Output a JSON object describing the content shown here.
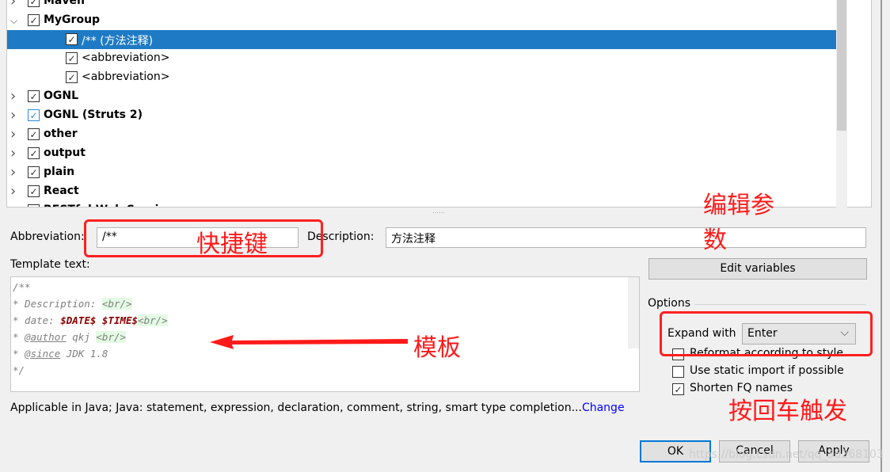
{
  "tree": {
    "items": [
      {
        "label": "Maven",
        "bold": true,
        "checked": true,
        "level": 0,
        "expanded": false
      },
      {
        "label": "MyGroup",
        "bold": true,
        "checked": true,
        "level": 0,
        "expanded": true
      },
      {
        "label": "/** (方法注释)",
        "bold": false,
        "checked": true,
        "level": 1,
        "selected": true
      },
      {
        "label": "<abbreviation>",
        "bold": false,
        "checked": true,
        "level": 1
      },
      {
        "label": "<abbreviation>",
        "bold": false,
        "checked": true,
        "level": 1
      },
      {
        "label": "OGNL",
        "bold": true,
        "checked": true,
        "level": 0,
        "expanded": false
      },
      {
        "label": "OGNL (Struts 2)",
        "bold": true,
        "checked": true,
        "level": 0,
        "expanded": false
      },
      {
        "label": "other",
        "bold": true,
        "checked": true,
        "level": 0,
        "expanded": false
      },
      {
        "label": "output",
        "bold": true,
        "checked": true,
        "level": 0,
        "expanded": false
      },
      {
        "label": "plain",
        "bold": true,
        "checked": true,
        "level": 0,
        "expanded": false
      },
      {
        "label": "React",
        "bold": true,
        "checked": true,
        "level": 0,
        "expanded": false
      },
      {
        "label": "RESTful Web Services",
        "bold": true,
        "checked": true,
        "level": 0,
        "expanded": false
      }
    ]
  },
  "form": {
    "abbreviation_label": "Abbreviation:",
    "abbreviation_value": "/**",
    "description_label": "Description:",
    "description_value": "方法注释",
    "template_label": "Template text:",
    "template_lines": {
      "l1": "/**",
      "l2a": "* Description: ",
      "l2b": "<br/>",
      "l3a": "* date: ",
      "l3b": "$DATE$",
      "l3c": " ",
      "l3d": "$TIME$",
      "l3e": "<br/>",
      "l4a": "* ",
      "l4b": "@author",
      "l4c": " qkj ",
      "l4d": "<br/>",
      "l5a": "* ",
      "l5b": "@since",
      "l5c": " JDK 1.8",
      "l6": "*/"
    },
    "edit_variables": "Edit variables",
    "options_label": "Options",
    "expand_with_label": "Expand with",
    "expand_with_value": "Enter",
    "reformat": {
      "label": "Reformat according to style",
      "checked": false
    },
    "static_import": {
      "label": "Use static import if possible",
      "checked": false
    },
    "shorten_fq": {
      "label": "Shorten FQ names",
      "checked": true
    },
    "applicable": "Applicable in Java; Java: statement, expression, declaration, comment, string, smart type completion...",
    "change_link": "Change"
  },
  "buttons": {
    "ok": "OK",
    "cancel": "Cancel",
    "apply": "Apply"
  },
  "annotations": {
    "shortcut": "快捷键",
    "edit_params": "编辑参数",
    "template": "模板",
    "enter_trigger": "按回车触发"
  },
  "watermark": "https://blog.csdn.net/qq_36268103",
  "colors": {
    "selection": "#1e7ac4",
    "annotation": "#ff1a1a",
    "link": "#0000ff"
  }
}
